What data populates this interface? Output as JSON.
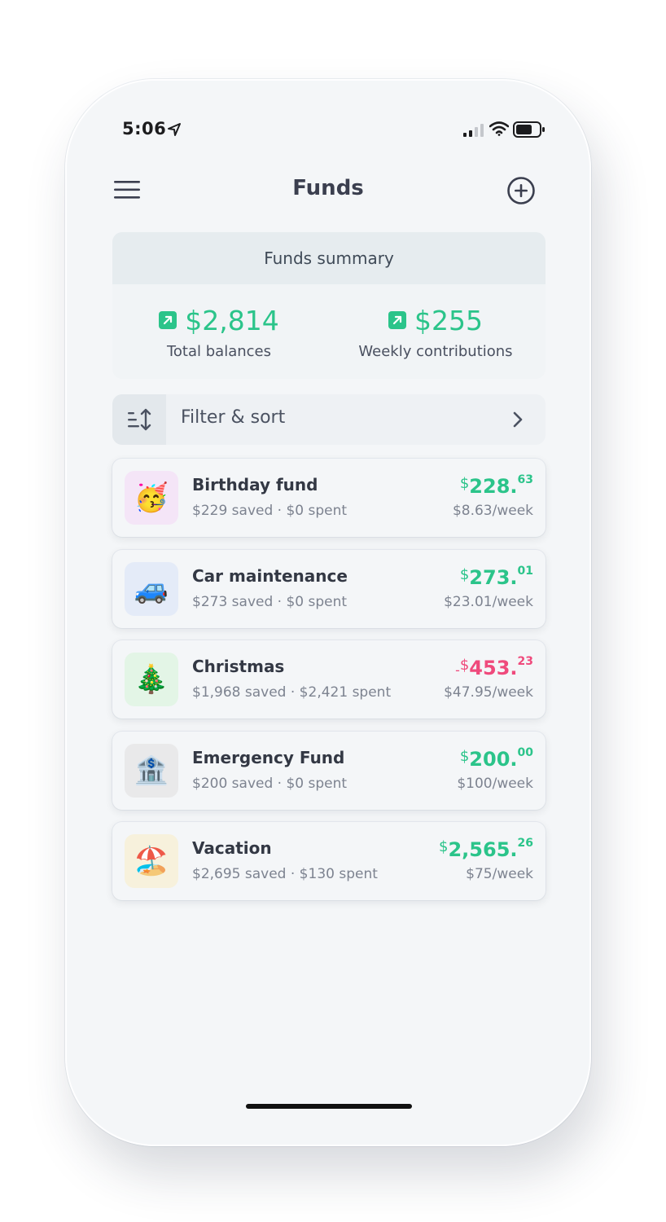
{
  "status_bar": {
    "time": "5:06"
  },
  "header": {
    "title": "Funds"
  },
  "summary": {
    "title": "Funds summary",
    "total_balances_value": "$2,814",
    "total_balances_label": "Total balances",
    "weekly_contributions_value": "$255",
    "weekly_contributions_label": "Weekly contributions"
  },
  "filter": {
    "label": "Filter & sort"
  },
  "funds": [
    {
      "emoji": "🥳",
      "name": "Birthday fund",
      "sub": "$229 saved · $0 spent",
      "sign": "",
      "currency": "$",
      "main": "228.",
      "cents": "63",
      "weekly": "$8.63/week",
      "tone": "pos",
      "bg": "#f4e5f7"
    },
    {
      "emoji": "🚙",
      "name": "Car maintenance",
      "sub": "$273 saved · $0 spent",
      "sign": "",
      "currency": "$",
      "main": "273.",
      "cents": "01",
      "weekly": "$23.01/week",
      "tone": "pos",
      "bg": "#e4ebf8"
    },
    {
      "emoji": "🎄",
      "name": "Christmas",
      "sub": "$1,968 saved · $2,421 spent",
      "sign": "-",
      "currency": "$",
      "main": "453.",
      "cents": "23",
      "weekly": "$47.95/week",
      "tone": "neg",
      "bg": "#e3f5e6"
    },
    {
      "emoji": "🏦",
      "name": "Emergency Fund",
      "sub": "$200 saved · $0 spent",
      "sign": "",
      "currency": "$",
      "main": "200.",
      "cents": "00",
      "weekly": "$100/week",
      "tone": "pos",
      "bg": "#e9e9ea"
    },
    {
      "emoji": "🏖️",
      "name": "Vacation",
      "sub": "$2,695 saved · $130 spent",
      "sign": "",
      "currency": "$",
      "main": "2,565.",
      "cents": "26",
      "weekly": "$75/week",
      "tone": "pos",
      "bg": "#f7f1dc"
    }
  ],
  "colors": {
    "positive": "#2bc48a",
    "negative": "#ef4a7c",
    "text": "#3b3f4f",
    "muted": "#7d8390"
  },
  "icons": [
    "location-arrow-icon",
    "cellular-signal-icon",
    "wifi-icon",
    "battery-icon",
    "hamburger-menu-icon",
    "plus-circle-icon",
    "trend-up-icon",
    "sort-icon",
    "chevron-right-icon"
  ]
}
